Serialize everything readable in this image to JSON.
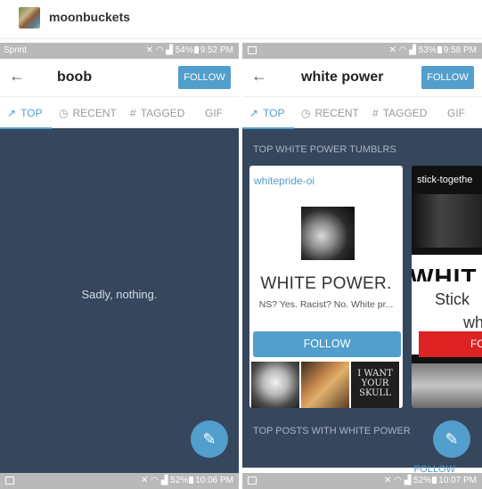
{
  "post": {
    "username": "moonbuckets"
  },
  "left_phone": {
    "status": {
      "carrier": "Sprint",
      "right": "54%",
      "time": "9:52 PM"
    },
    "title": "boob",
    "follow_label": "FOLLOW",
    "tabs": [
      {
        "label": "TOP",
        "icon": "trending-icon"
      },
      {
        "label": "RECENT",
        "icon": "clock-icon"
      },
      {
        "label": "TAGGED",
        "icon": "hash-icon"
      },
      {
        "label": "GIF"
      }
    ],
    "empty_text": "Sadly, nothing.",
    "bottom_status": {
      "battery": "52%",
      "time": "10:06 PM"
    }
  },
  "right_phone": {
    "status": {
      "battery": "53%",
      "time": "9:58 PM"
    },
    "title": "white power",
    "follow_label": "FOLLOW",
    "tabs": [
      {
        "label": "TOP",
        "icon": "trending-icon"
      },
      {
        "label": "RECENT",
        "icon": "clock-icon"
      },
      {
        "label": "TAGGED",
        "icon": "hash-icon"
      },
      {
        "label": "GIF"
      }
    ],
    "section_top_tumblrs": "TOP WHITE POWER TUMBLRS",
    "card1": {
      "blog_name": "whitepride-oi",
      "title": "WHITE POWER.",
      "description": "NS? Yes. Racist? No. White pr...",
      "follow_label": "FOLLOW",
      "thumb3_text": "I WANT YOUR SKULL"
    },
    "card2": {
      "blog_name": "stick-togethe",
      "banner": "WHIT",
      "stick_line1": "Stick",
      "stick_line2": "wh",
      "follow_label": "FO"
    },
    "section_top_posts": "TOP POSTS WITH WHITE POWER",
    "peek_follow": "FOLLOW",
    "bottom_status": {
      "battery": "52%",
      "time": "10:07 PM"
    }
  },
  "colors": {
    "accent": "#529ecc",
    "dark_bg": "#36465d"
  }
}
